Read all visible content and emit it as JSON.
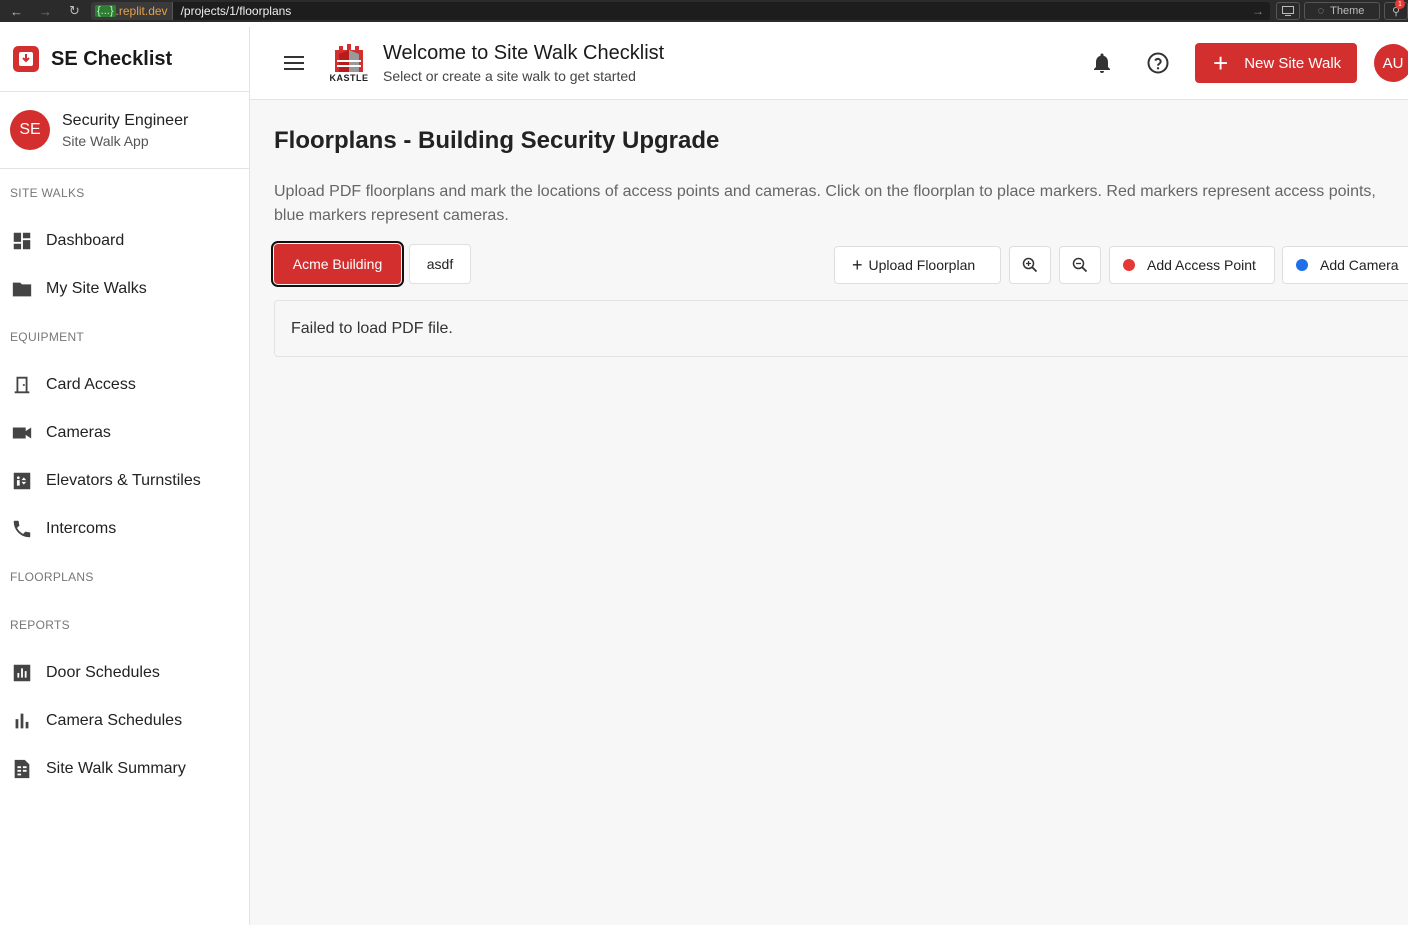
{
  "browser": {
    "domain_highlight": "{...}",
    "domain": ".replit.dev",
    "path": "/projects/1/floorplans",
    "theme_label": "Theme",
    "badge_count": "1"
  },
  "sidebar": {
    "app_title": "SE Checklist",
    "user_initials": "SE",
    "user_name": "Security Engineer",
    "user_subtitle": "Site Walk App",
    "sections": {
      "site_walks": "SITE WALKS",
      "equipment": "EQUIPMENT",
      "floorplans": "FLOORPLANS",
      "reports": "REPORTS"
    },
    "items": {
      "dashboard": "Dashboard",
      "my_site_walks": "My Site Walks",
      "card_access": "Card Access",
      "cameras": "Cameras",
      "elevators": "Elevators & Turnstiles",
      "intercoms": "Intercoms",
      "door_schedules": "Door Schedules",
      "camera_schedules": "Camera Schedules",
      "site_walk_summary": "Site Walk Summary"
    }
  },
  "header": {
    "logo_word": "KASTLE",
    "title": "Welcome to Site Walk Checklist",
    "subtitle": "Select or create a site walk to get started",
    "new_button": "New Site Walk",
    "user_initials": "AU"
  },
  "main": {
    "title": "Floorplans - Building Security Upgrade",
    "description": "Upload PDF floorplans and mark the locations of access points and cameras. Click on the floorplan to place markers. Red markers represent access points, blue markers represent cameras.",
    "tabs": [
      "Acme Building",
      "asdf"
    ],
    "upload_label": "Upload Floorplan",
    "add_access_label": "Add Access Point",
    "add_camera_label": "Add Camera",
    "error_message": "Failed to load PDF file."
  },
  "colors": {
    "brand_red": "#d32f2f",
    "access_marker": "#e53935",
    "camera_marker": "#1e6fe8"
  }
}
